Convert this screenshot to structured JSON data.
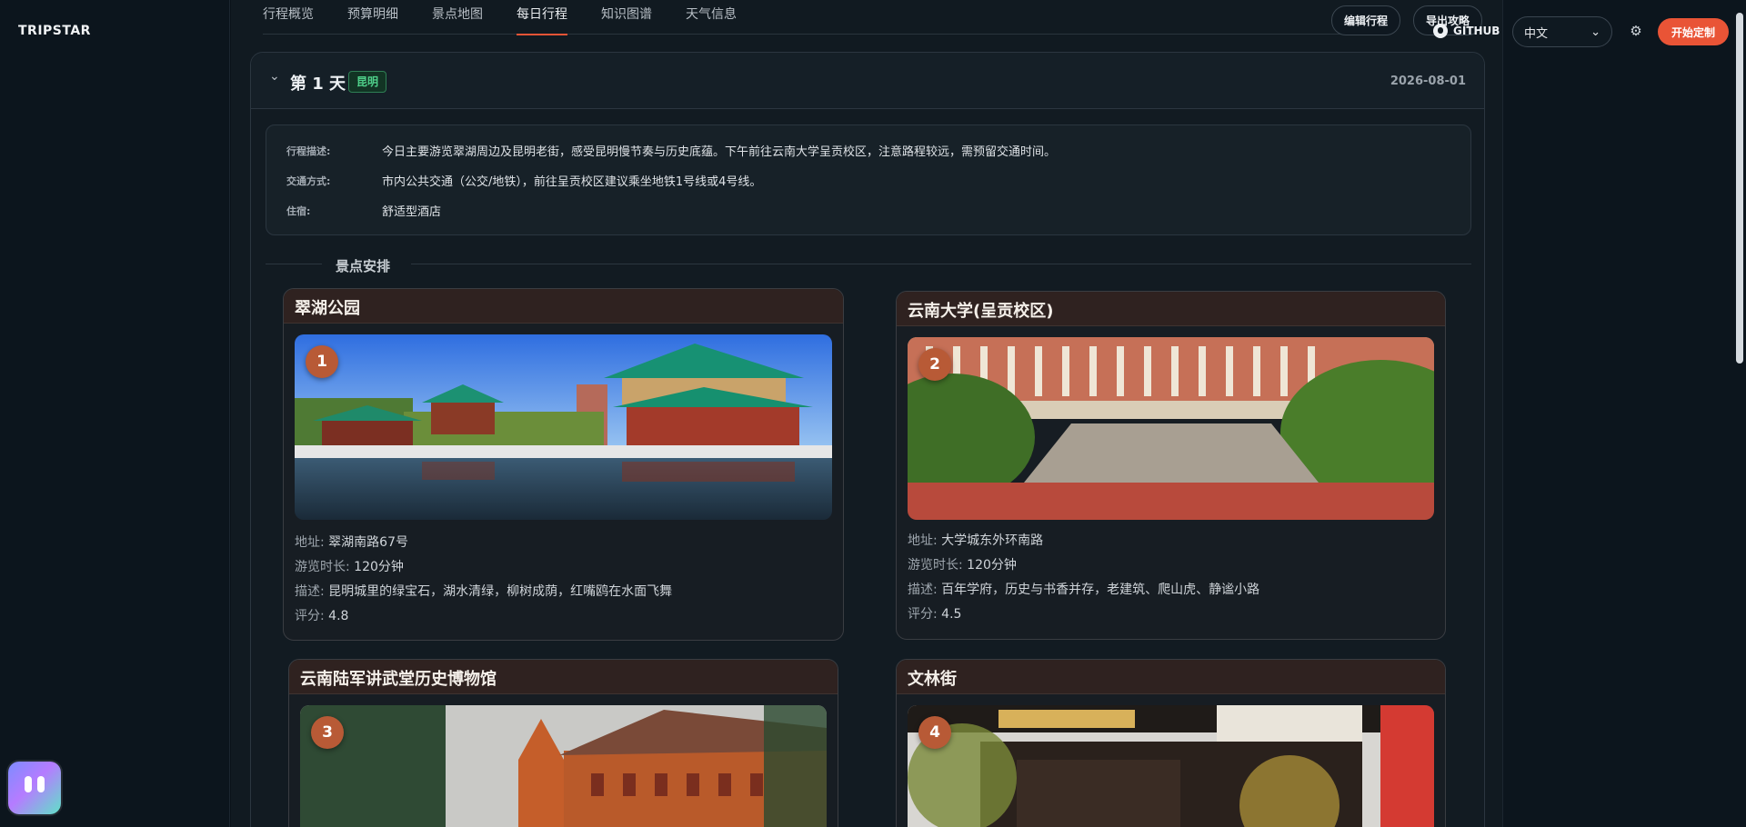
{
  "brand": "TRIPSTAR",
  "tabs": [
    {
      "label": "行程概览"
    },
    {
      "label": "预算明细"
    },
    {
      "label": "景点地图"
    },
    {
      "label": "每日行程"
    },
    {
      "label": "知识图谱"
    },
    {
      "label": "天气信息"
    }
  ],
  "active_tab": "每日行程",
  "header": {
    "edit_label": "编辑行程",
    "export_label": "导出攻略",
    "github_label": "GITHUB",
    "language": "中文",
    "start_label": "开始定制"
  },
  "day": {
    "title": "第 1 天",
    "city": "昆明",
    "date": "2026-08-01",
    "info": [
      {
        "key": "行程描述:",
        "value": "今日主要游览翠湖周边及昆明老街，感受昆明慢节奏与历史底蕴。下午前往云南大学呈贡校区，注意路程较远，需预留交通时间。"
      },
      {
        "key": "交通方式:",
        "value": "市内公共交通（公交/地铁），前往呈贡校区建议乘坐地铁1号线或4号线。"
      },
      {
        "key": "住宿:",
        "value": "舒适型酒店"
      }
    ],
    "section_title": "景点安排"
  },
  "labels": {
    "address": "地址: ",
    "duration": "游览时长: ",
    "description": "描述: ",
    "rating": "评分: "
  },
  "spots": [
    {
      "index": "1",
      "name": "翠湖公园",
      "address": "翠湖南路67号",
      "duration": "120分钟",
      "description": "昆明城里的绿宝石，湖水清绿，柳树成荫，红嘴鸥在水面飞舞",
      "rating": "4.8"
    },
    {
      "index": "2",
      "name": "云南大学(呈贡校区)",
      "address": "大学城东外环南路",
      "duration": "120分钟",
      "description": "百年学府，历史与书香并存，老建筑、爬山虎、静谧小路",
      "rating": "4.5"
    },
    {
      "index": "3",
      "name": "云南陆军讲武堂历史博物馆"
    },
    {
      "index": "4",
      "name": "文林街"
    }
  ]
}
